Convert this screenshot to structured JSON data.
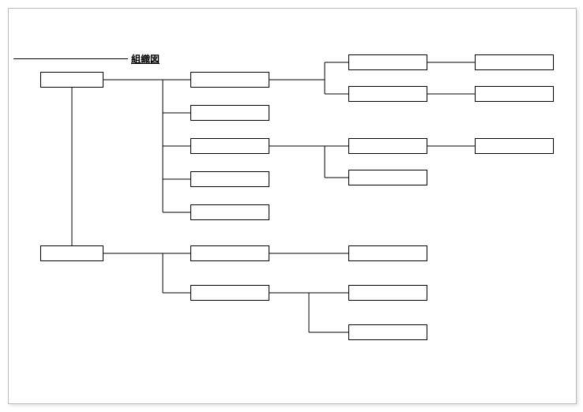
{
  "title": "組織図",
  "boxes": {
    "root1": "",
    "root2": "",
    "a1": "",
    "a2": "",
    "a3": "",
    "a4": "",
    "a5": "",
    "b1": "",
    "b2": "",
    "b3": "",
    "b4": "",
    "c1": "",
    "c2": "",
    "c3": "",
    "c4": "",
    "d1": "",
    "d2": "",
    "e1": "",
    "e2": "",
    "e3": ""
  }
}
